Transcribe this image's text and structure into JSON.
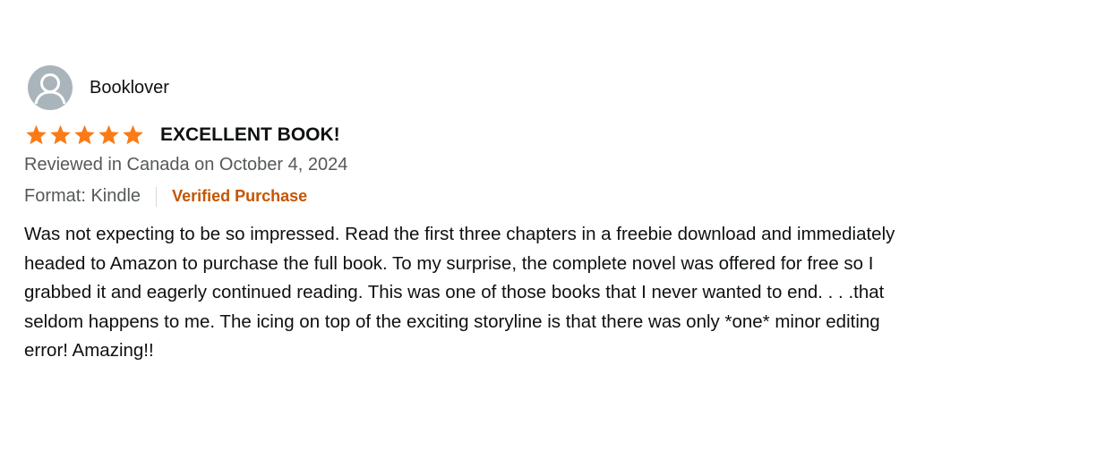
{
  "review": {
    "reviewer_name": "Booklover",
    "avatar_icon": "user-silhouette-icon",
    "rating": 5,
    "rating_max": 5,
    "star_color": "#fa7b17",
    "title": "EXCELLENT BOOK!",
    "meta": "Reviewed in Canada on October 4, 2024",
    "format": "Format: Kindle",
    "verified_label": "Verified Purchase",
    "verified_color": "#c45500",
    "body_lines": [
      "Was not expecting to be so impressed. Read the first three chapters in a freebie download and immediately",
      "headed to Amazon to purchase the full book. To my surprise, the complete novel was offered for free so I",
      "grabbed it and eagerly continued reading. This was one of those books that I never wanted to end. . . .that",
      "seldom happens to me. The icing on top of the exciting storyline is that there was only *one* minor editing",
      "error! Amazing!!"
    ]
  }
}
